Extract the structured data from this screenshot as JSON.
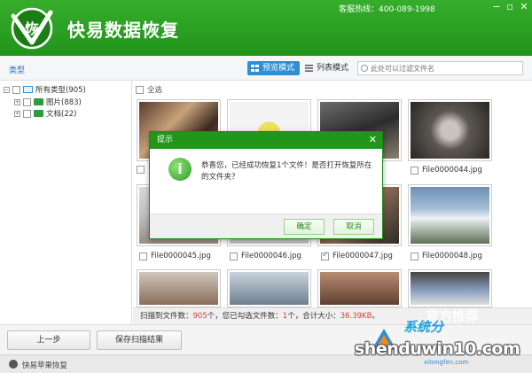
{
  "app": {
    "title": "快易数据恢复",
    "logo_char": "恢",
    "hotline": "客服热线：400-089-1998"
  },
  "window_controls": [
    "minimize-icon",
    "restore-icon",
    "close-icon"
  ],
  "toolbar": {
    "type_label": "类型",
    "preview_mode": "预览模式",
    "list_mode": "列表模式",
    "search_placeholder": "此处可以过滤文件名"
  },
  "tree": {
    "root": {
      "label": "所有类型(905)",
      "expander": "−"
    },
    "items": [
      {
        "label": "图片(883)",
        "expander": "+"
      },
      {
        "label": "文档(22)",
        "expander": "+"
      }
    ]
  },
  "grid": {
    "select_all": "全选",
    "rows": [
      {
        "items": [
          {
            "caption": "",
            "checked": false
          },
          {
            "caption": "",
            "checked": false
          },
          {
            "caption": "",
            "checked": false
          },
          {
            "caption": "File0000044.jpg",
            "checked": false
          }
        ]
      },
      {
        "items": [
          {
            "caption": "File0000045.jpg",
            "checked": false
          },
          {
            "caption": "File0000046.jpg",
            "checked": false
          },
          {
            "caption": "File0000047.jpg",
            "checked": true
          },
          {
            "caption": "File0000048.jpg",
            "checked": false
          }
        ]
      },
      {
        "items": [
          {
            "caption": "",
            "checked": false
          },
          {
            "caption": "",
            "checked": false
          },
          {
            "caption": "",
            "checked": false
          },
          {
            "caption": "",
            "checked": false
          }
        ]
      }
    ]
  },
  "status": {
    "prefix": "扫描到文件数：",
    "scanned": "905",
    "mid1": "个，您已勾选文件数：",
    "selected": "1",
    "mid2": "个，合计大小：",
    "size": "36.39KB",
    "suffix": "。"
  },
  "buttons": {
    "prev": "上一步",
    "save_scan": "保存扫描结果"
  },
  "footer": {
    "label": "快易苹果恢复"
  },
  "dialog": {
    "title": "提示",
    "icon_char": "i",
    "message": "恭喜您，已经成功恢复1个文件！是否打开恢复所在的文件夹？",
    "ok": "确定",
    "cancel": "取消"
  },
  "watermark": {
    "main": "shenduwin10.com",
    "sub": "系统分",
    "url": "xitongfen.com",
    "ghost": "官方推荐"
  },
  "colors": {
    "brand_green": "#22961b",
    "accent_blue": "#2d8fd5",
    "highlight_red": "#e4393c"
  }
}
